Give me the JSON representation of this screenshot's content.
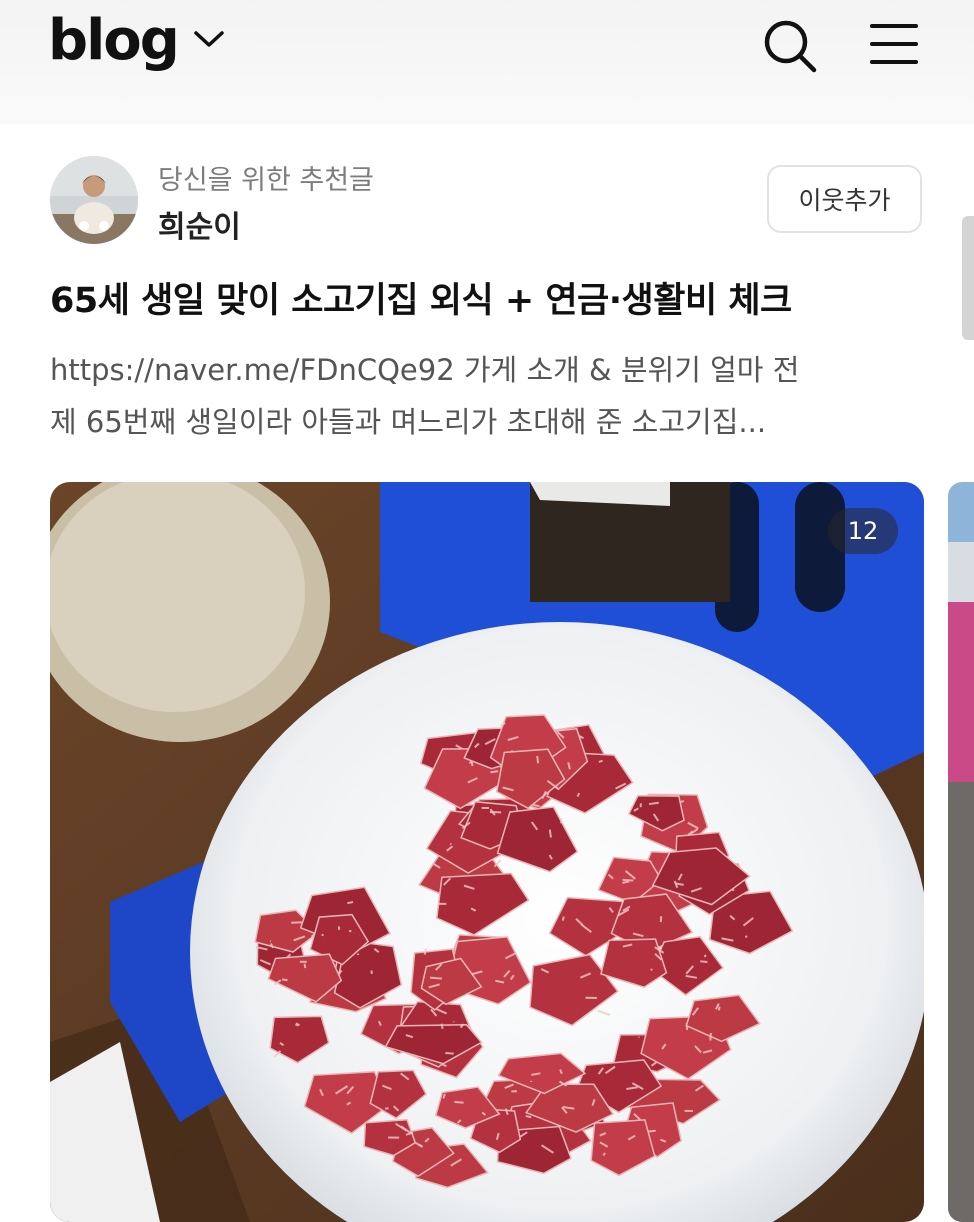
{
  "header": {
    "logo_text": "blog",
    "dropdown_icon": "chevron-down-icon",
    "search_icon": "search-icon",
    "menu_icon": "hamburger-menu-icon"
  },
  "post": {
    "recommend_label": "당신을 위한 추천글",
    "author_name": "희순이",
    "follow_label": "이웃추가",
    "title": "65세 생일 맞이 소고기집 외식 + 연금·생활비 체크",
    "excerpt_line1": "https://naver.me/FDnCQe92 가게 소개 & 분위기 얼마 전",
    "excerpt_line2": "제 65번째 생일이라 아들과 며느리가 초대해 준 소고기집...",
    "image_count": "12"
  },
  "colors": {
    "tray_blue": "#1f4fd6",
    "plate_white": "#f1f3f5",
    "meat_red": "#b4323f",
    "table_wood": "#5a3a22"
  }
}
